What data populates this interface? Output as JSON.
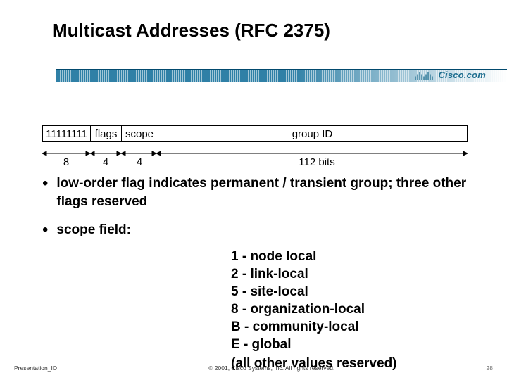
{
  "title": "Multicast Addresses (RFC 2375)",
  "brand": "Cisco.com",
  "diagram": {
    "fields": [
      "11111111",
      "flags",
      "scope",
      "group ID"
    ],
    "widths": [
      "8",
      "4",
      "4",
      "112 bits"
    ]
  },
  "bullets": {
    "b1": "low-order flag indicates permanent / transient group; three other flags reserved",
    "b2_label": "scope field:",
    "scope": {
      "l1": "1 - node local",
      "l2": "2 - link-local",
      "l3": "5 - site-local",
      "l4": "8 - organization-local",
      "l5": "B - community-local",
      "l6": "E - global",
      "note": "(all other values reserved)"
    }
  },
  "footer": {
    "left": "Presentation_ID",
    "center": "© 2001, Cisco Systems, Inc. All rights reserved.",
    "page": "28"
  }
}
